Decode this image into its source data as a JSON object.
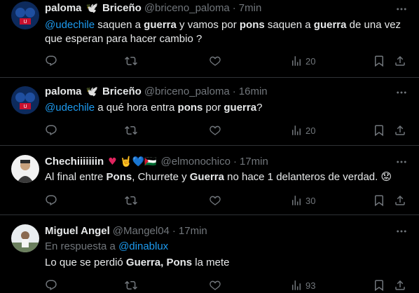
{
  "tweets": [
    {
      "name": "paloma",
      "name_emoji": "🕊️",
      "name2": "Briceño",
      "handle": "@briceno_paloma",
      "sep": "·",
      "time": "7min",
      "text_parts": [
        {
          "t": "@udechile",
          "cls": "mention"
        },
        {
          "t": " saquen a ",
          "cls": ""
        },
        {
          "t": "guerra",
          "cls": "b"
        },
        {
          "t": " y vamos por ",
          "cls": ""
        },
        {
          "t": "pons",
          "cls": "b"
        },
        {
          "t": " saquen a ",
          "cls": ""
        },
        {
          "t": "guerra",
          "cls": "b"
        },
        {
          "t": " de una vez que esperan para hacer cambio ?",
          "cls": ""
        }
      ],
      "views": "20"
    },
    {
      "name": "paloma",
      "name_emoji": "🕊️",
      "name2": "Briceño",
      "handle": "@briceno_paloma",
      "sep": "·",
      "time": "16min",
      "text_parts": [
        {
          "t": "@udechile",
          "cls": "mention"
        },
        {
          "t": " a qué hora entra ",
          "cls": ""
        },
        {
          "t": "pons",
          "cls": "b"
        },
        {
          "t": " por ",
          "cls": ""
        },
        {
          "t": "guerra",
          "cls": "b"
        },
        {
          "t": "?",
          "cls": ""
        }
      ],
      "views": "20"
    },
    {
      "name": "Chechiiiiiiin",
      "name_emoji": "♥ 🤘💙🇵🇸",
      "name2": "",
      "handle": "@elmonochico",
      "sep": "·",
      "time": "17min",
      "text_parts": [
        {
          "t": "Al final entre ",
          "cls": ""
        },
        {
          "t": "Pons",
          "cls": "b"
        },
        {
          "t": ", Churrete y ",
          "cls": ""
        },
        {
          "t": "Guerra",
          "cls": "b"
        },
        {
          "t": " no hace 1 delanteros de verdad. 😟",
          "cls": ""
        }
      ],
      "views": "30"
    },
    {
      "name": "Miguel Angel",
      "name_emoji": "",
      "name2": "",
      "handle": "@Mangel04",
      "sep": "·",
      "time": "17min",
      "reply_prefix": "En respuesta a ",
      "reply_to": "@dinablux",
      "text_parts": [
        {
          "t": "Lo que se perdió ",
          "cls": ""
        },
        {
          "t": "Guerra, Pons",
          "cls": "b"
        },
        {
          "t": " la mete",
          "cls": ""
        }
      ],
      "views": "93"
    }
  ],
  "colors": {
    "background": "#000000",
    "text": "#e7e9ea",
    "muted": "#71767b",
    "accent": "#1d9bf0",
    "divider": "#2f3336"
  }
}
